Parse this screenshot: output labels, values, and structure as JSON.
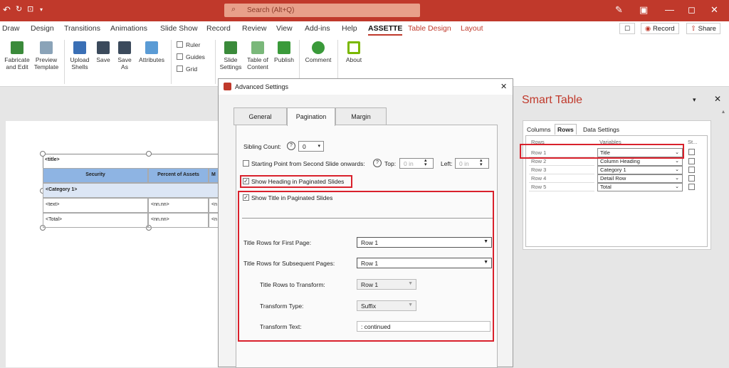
{
  "titlebar": {
    "search_placeholder": "Search (Alt+Q)"
  },
  "ribbon_tabs": [
    "Draw",
    "Design",
    "Transitions",
    "Animations",
    "Slide Show",
    "Record",
    "Review",
    "View",
    "Add-ins",
    "Help",
    "ASSETTE",
    "Table Design",
    "Layout"
  ],
  "ribbon_right": {
    "record": "Record",
    "share": "Share"
  },
  "ribbon": {
    "fabricate": "Fabricate\nand Edit",
    "preview": "Preview\nTemplate",
    "upload": "Upload\nShells",
    "save": "Save",
    "save_as": "Save\nAs",
    "attributes": "Attributes",
    "ruler": "Ruler",
    "guides": "Guides",
    "grid": "Grid",
    "slide_settings": "Slide\nSettings",
    "table_of_content": "Table of\nContent",
    "publish": "Publish",
    "comment": "Comment",
    "about": "About"
  },
  "slide": {
    "title": "<title>",
    "headers": [
      "Security",
      "Percent of Assets",
      "M"
    ],
    "category": "<Category 1>",
    "rows": [
      [
        "<text>",
        "<nn.nn>",
        "<n"
      ],
      [
        "<Total>",
        "<nn.nn>",
        "<n"
      ]
    ]
  },
  "dialog": {
    "title": "Advanced Settings",
    "close": "✕",
    "tabs": [
      "General",
      "Pagination",
      "Margin"
    ],
    "sibling_count_label": "Sibling Count:",
    "sibling_count_value": "0",
    "starting_point_label": "Starting Point from Second Slide onwards:",
    "top_label": "Top:",
    "top_placeholder": "0 in",
    "left_label": "Left:",
    "left_placeholder": "0 in",
    "show_heading": "Show Heading in Paginated Slides",
    "show_title": "Show Title in Paginated Slides",
    "first_page_label": "Title Rows for First Page:",
    "first_page_value": "Row 1",
    "subsequent_label": "Title Rows for Subsequent Pages:",
    "subsequent_value": "Row 1",
    "transform_rows_label": "Title Rows to Transform:",
    "transform_rows_value": "Row 1",
    "transform_type_label": "Transform Type:",
    "transform_type_value": "Suffix",
    "transform_text_label": "Transform Text:",
    "transform_text_value": ": continued"
  },
  "smart_table": {
    "title": "Smart Table",
    "tabs": [
      "Columns",
      "Rows",
      "Data Settings"
    ],
    "col_headers": [
      "Rows",
      "Variables",
      "St..."
    ],
    "rows": [
      [
        "Row 1",
        "Title"
      ],
      [
        "Row 2",
        "Column Heading"
      ],
      [
        "Row 3",
        "Category 1"
      ],
      [
        "Row 4",
        "Detail Row"
      ],
      [
        "Row 5",
        "Total"
      ]
    ]
  },
  "colors": {
    "accent": "#c0392b",
    "highlight": "#d9212c"
  }
}
